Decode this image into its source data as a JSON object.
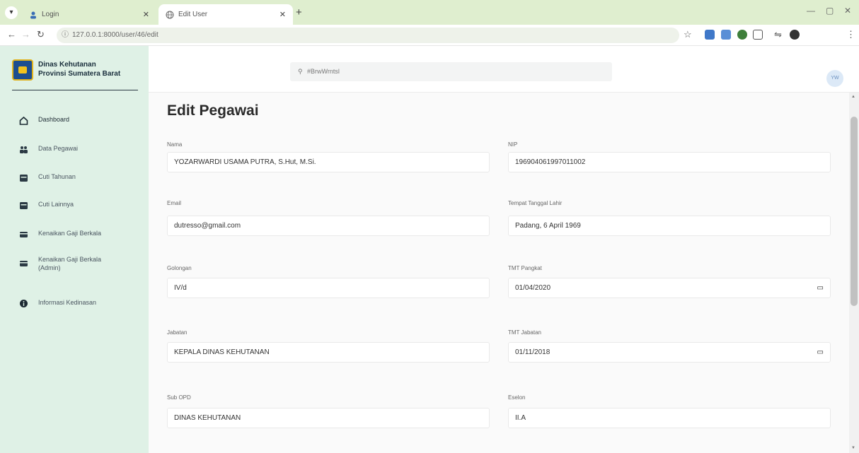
{
  "browser": {
    "tabs": [
      {
        "title": "Login",
        "active": false
      },
      {
        "title": "Edit User",
        "active": true
      }
    ],
    "address": "127.0.0.1:8000/user/46/edit",
    "new_tab_symbol": "+",
    "window_controls": [
      "—",
      "▢",
      "✕"
    ]
  },
  "brand": {
    "line1": "Dinas Kehutanan",
    "line2": "Provinsi Sumatera Barat"
  },
  "sidebar": {
    "items": [
      {
        "label": "Dashboard",
        "icon": "home-icon",
        "active": true
      },
      {
        "label": "Data Pegawai",
        "icon": "users-icon",
        "active": false
      },
      {
        "label": "Cuti Tahunan",
        "icon": "calendar-icon",
        "active": false
      },
      {
        "label": "Cuti Lainnya",
        "icon": "calendar-icon",
        "active": false
      },
      {
        "label": "Kenaikan Gaji Berkala",
        "icon": "card-icon",
        "active": false
      },
      {
        "label": "Kenaikan Gaji Berkala (Admin)",
        "icon": "card-icon",
        "active": false
      },
      {
        "label": "Informasi Kedinasan",
        "icon": "info-icon",
        "active": false
      }
    ]
  },
  "header": {
    "search_placeholder": "#BrwWrntsl",
    "avatar_initials": "YW"
  },
  "form": {
    "title": "Edit Pegawai",
    "fields": {
      "nama": {
        "label": "Nama",
        "value": "YOZARWARDI USAMA PUTRA, S.Hut, M.Si."
      },
      "nip": {
        "label": "NIP",
        "value": "196904061997011002"
      },
      "email": {
        "label": "Email",
        "value": "dutresso@gmail.com"
      },
      "ttl": {
        "label": "Tempat Tanggal Lahir",
        "value": "Padang, 6 April 1969"
      },
      "golongan": {
        "label": "Golongan",
        "value": "IV/d"
      },
      "tmt_pangkat": {
        "label": "TMT Pangkat",
        "value": "01/04/2020"
      },
      "jabatan": {
        "label": "Jabatan",
        "value": "KEPALA DINAS KEHUTANAN"
      },
      "tmt_jabatan": {
        "label": "TMT Jabatan",
        "value": "01/11/2018"
      },
      "sub_opd": {
        "label": "Sub OPD",
        "value": "DINAS KEHUTANAN"
      },
      "eselon": {
        "label": "Eselon",
        "value": "II.A"
      }
    }
  },
  "colors": {
    "tabstrip": "#dfeecf",
    "sidebar": "#dff1e6",
    "brand_logo": "#1d4e8f"
  }
}
